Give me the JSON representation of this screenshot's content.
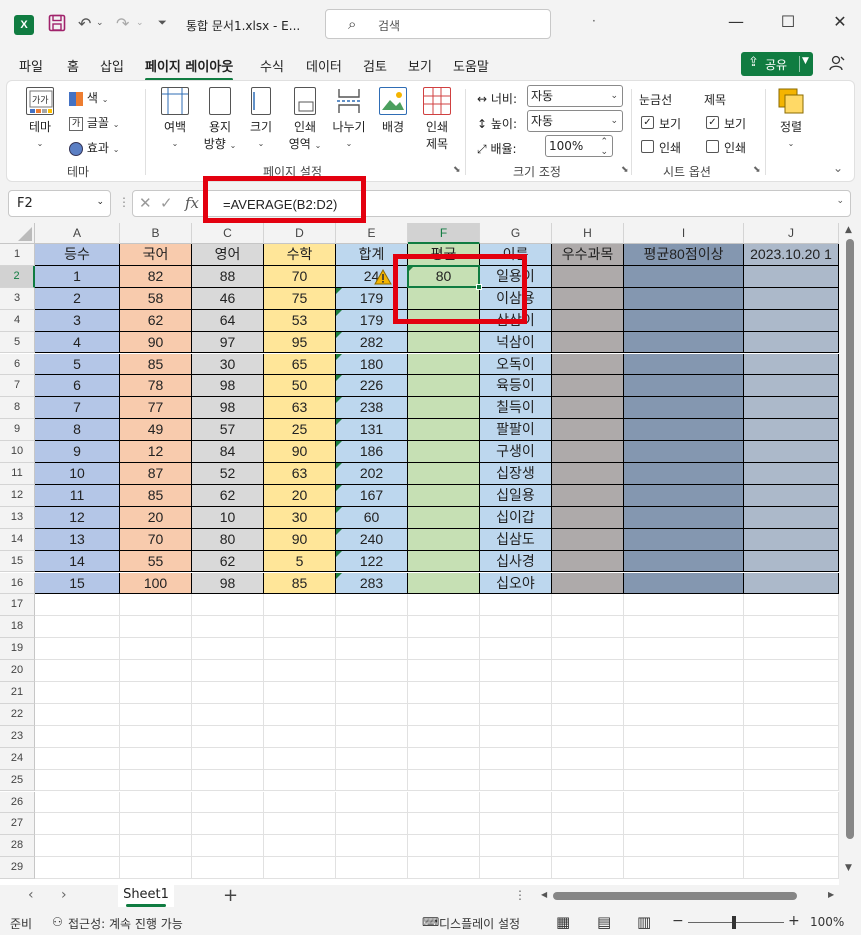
{
  "titlebar": {
    "app_logo": "X",
    "doc_title": "통합 문서1.xlsx - E...",
    "search_placeholder": "검색",
    "dot": "·"
  },
  "tabs": [
    "파일",
    "홈",
    "삽입",
    "페이지 레이아웃",
    "수식",
    "데이터",
    "검토",
    "보기",
    "도움말"
  ],
  "share_label": "공유",
  "ribbon": {
    "theme_group": {
      "label": "테마",
      "theme_btn": "테마",
      "colors": "색",
      "fonts": "글꼴",
      "effects": "효과"
    },
    "page_setup_group": {
      "label": "페이지 설정",
      "margins": "여백",
      "orientation_1": "용지",
      "orientation_2": "방향",
      "size": "크기",
      "print_area_1": "인쇄",
      "print_area_2": "영역",
      "breaks": "나누기",
      "background": "배경",
      "print_titles_1": "인쇄",
      "print_titles_2": "제목"
    },
    "scale_group": {
      "label": "크기 조정",
      "width_label": "너비:",
      "width_value": "자동",
      "height_label": "높이:",
      "height_value": "자동",
      "scale_label": "배율:",
      "scale_value": "100%"
    },
    "sheet_options_group": {
      "label": "시트 옵션",
      "gridlines": "눈금선",
      "headings": "제목",
      "view": "보기",
      "print": "인쇄"
    },
    "arrange": "정렬"
  },
  "formula_bar": {
    "name_box": "F2",
    "fx": "fx",
    "formula": "=AVERAGE(B2:D2)"
  },
  "columns": [
    "A",
    "B",
    "C",
    "D",
    "E",
    "F",
    "G",
    "H",
    "I",
    "J"
  ],
  "header_row": [
    "등수",
    "국어",
    "영어",
    "수학",
    "합계",
    "평균",
    "이름",
    "우수과목",
    "평균80점이상",
    "2023.10.20 1"
  ],
  "rows": [
    [
      "1",
      "82",
      "88",
      "70",
      "24",
      "80",
      "일용이"
    ],
    [
      "2",
      "58",
      "46",
      "75",
      "179",
      "",
      "이삼용"
    ],
    [
      "3",
      "62",
      "64",
      "53",
      "179",
      "",
      "삼삼이"
    ],
    [
      "4",
      "90",
      "97",
      "95",
      "282",
      "",
      "넉삼이"
    ],
    [
      "5",
      "85",
      "30",
      "65",
      "180",
      "",
      "오독이"
    ],
    [
      "6",
      "78",
      "98",
      "50",
      "226",
      "",
      "육등이"
    ],
    [
      "7",
      "77",
      "98",
      "63",
      "238",
      "",
      "칠득이"
    ],
    [
      "8",
      "49",
      "57",
      "25",
      "131",
      "",
      "팔팔이"
    ],
    [
      "9",
      "12",
      "84",
      "90",
      "186",
      "",
      "구생이"
    ],
    [
      "10",
      "87",
      "52",
      "63",
      "202",
      "",
      "십장생"
    ],
    [
      "11",
      "85",
      "62",
      "20",
      "167",
      "",
      "십일용"
    ],
    [
      "12",
      "20",
      "10",
      "30",
      "60",
      "",
      "십이갑"
    ],
    [
      "13",
      "70",
      "80",
      "90",
      "240",
      "",
      "십삼도"
    ],
    [
      "14",
      "55",
      "62",
      "5",
      "122",
      "",
      "십사경"
    ],
    [
      "15",
      "100",
      "98",
      "85",
      "283",
      "",
      "십오야"
    ]
  ],
  "row_numbers": [
    "1",
    "2",
    "3",
    "4",
    "5",
    "6",
    "7",
    "8",
    "9",
    "10",
    "11",
    "12",
    "13",
    "14",
    "15",
    "16",
    "17",
    "18",
    "19",
    "20",
    "21",
    "22",
    "23",
    "24",
    "25",
    "26",
    "27",
    "28",
    "29"
  ],
  "colors": {
    "accent": "#107c41",
    "col_a": "#b4c6e7",
    "col_b": "#f8cbad",
    "col_c": "#d9d9d9",
    "col_d": "#ffe699",
    "col_e": "#bdd7ee",
    "col_f": "#c6e0b4",
    "col_g": "#bdd7ee",
    "col_h": "#aeaaaa",
    "col_i": "#8497b0",
    "col_j": "#acb9ca",
    "highlight": "#e3000f"
  },
  "sheet_tab": "Sheet1",
  "status": {
    "ready": "준비",
    "accessibility": "접근성: 계속 진행 가능",
    "display_settings": "디스플레이 설정",
    "zoom": "100%"
  }
}
